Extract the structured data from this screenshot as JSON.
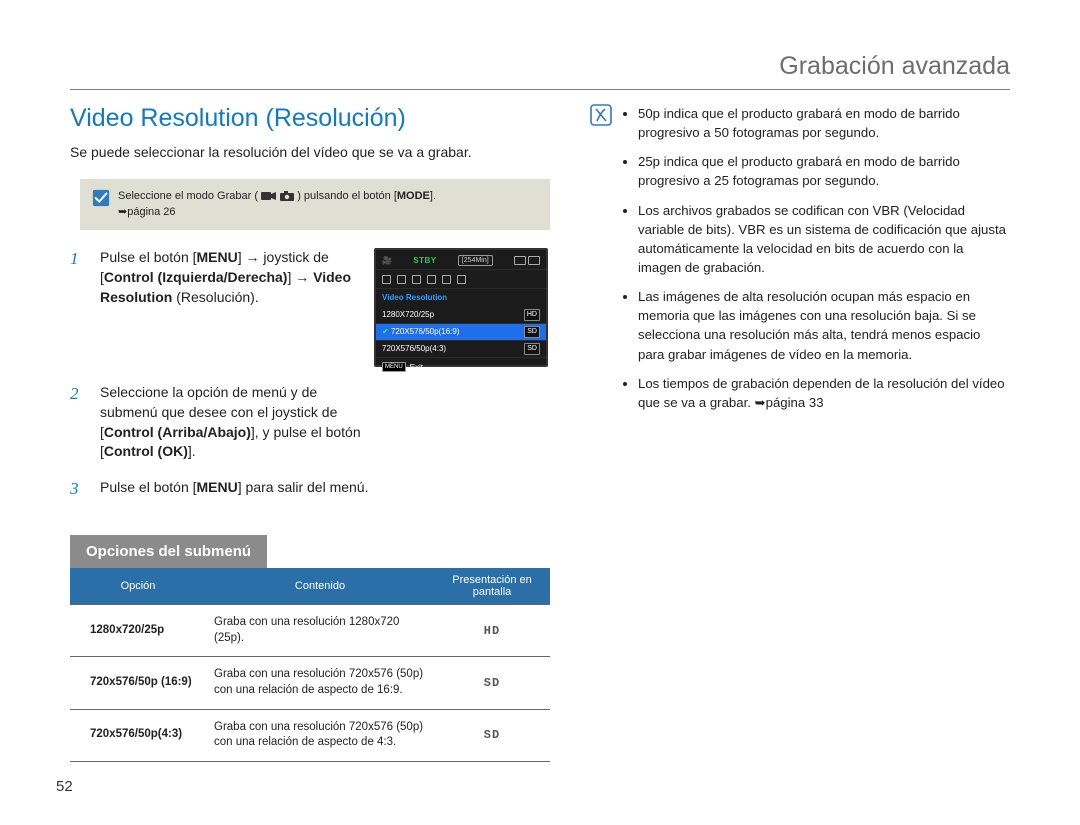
{
  "page": {
    "section_title": "Grabación avanzada",
    "page_number": "52"
  },
  "left": {
    "heading": "Video Resolution (Resolución)",
    "lead": "Se puede seleccionar la resolución del vídeo que se va a grabar.",
    "note_text_pre": "Seleccione el modo Grabar ( ",
    "note_text_post": " ) pulsando el botón [",
    "note_mode": "MODE",
    "note_close": "].",
    "note_page": "➥página 26",
    "steps": [
      {
        "n": "1",
        "parts": "Pulse el botón [MENU] → joystick de [Control (Izquierda/Derecha)] → Video Resolution (Resolución)."
      },
      {
        "n": "2",
        "parts": "Seleccione la opción de menú y de submenú que desee con el joystick de [Control (Arriba/Abajo)], y pulse el botón [Control (OK)]."
      },
      {
        "n": "3",
        "parts": "Pulse el botón [MENU] para salir del menú."
      }
    ],
    "lcd": {
      "stby": "STBY",
      "time": "[254Min]",
      "label": "Video Resolution",
      "items": [
        {
          "name": "1280X720/25p",
          "badge": "HD",
          "sel": false
        },
        {
          "name": "720X576/50p(16:9)",
          "badge": "SD",
          "sel": true
        },
        {
          "name": "720X576/50p(4:3)",
          "badge": "SD",
          "sel": false
        }
      ],
      "exit": "Exit",
      "menu": "MENU"
    },
    "submenu_title": "Opciones del submenú",
    "table": {
      "headers": [
        "Opción",
        "Contenido",
        "Presentación en pantalla"
      ],
      "rows": [
        {
          "opt": "1280x720/25p",
          "content": "Graba con una resolución 1280x720 (25p).",
          "disp": "HD"
        },
        {
          "opt": "720x576/50p (16:9)",
          "content": "Graba con una resolución 720x576 (50p) con una relación de aspecto de 16:9.",
          "disp": "SD"
        },
        {
          "opt": "720x576/50p(4:3)",
          "content": "Graba con una resolución 720x576 (50p) con una relación de aspecto de 4:3.",
          "disp": "SD"
        }
      ]
    }
  },
  "right": {
    "bullets": [
      "50p indica que el producto grabará en modo de barrido progresivo a 50 fotogramas por segundo.",
      "25p indica que el producto grabará en modo de barrido progresivo a 25 fotogramas por segundo.",
      "Los archivos grabados se codifican con VBR (Velocidad variable de bits). VBR es un sistema de codificación que ajusta automáticamente la velocidad en bits de acuerdo con la imagen de grabación.",
      "Las imágenes de alta resolución ocupan más espacio en memoria que las imágenes con una resolución baja. Si se selecciona una resolución más alta, tendrá menos espacio para grabar imágenes de vídeo en la memoria.",
      "Los tiempos de grabación dependen de la resolución del vídeo que se va a grabar. ➥página 33"
    ]
  }
}
